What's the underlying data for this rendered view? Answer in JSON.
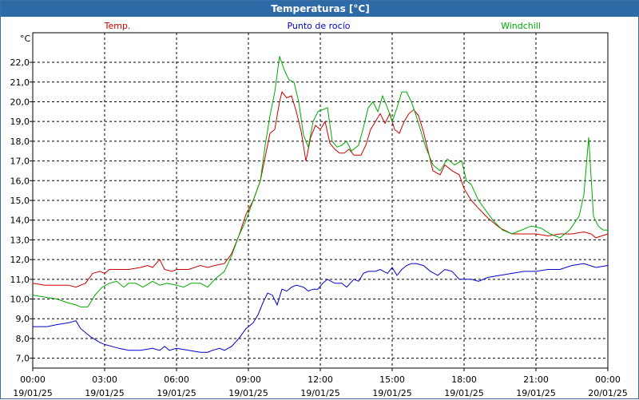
{
  "window": {
    "title": "Temperaturas [°C]"
  },
  "colors": {
    "temp": "#cc0000",
    "dew": "#0000cc",
    "chill": "#00aa00",
    "titlebar": "#2d6aa6",
    "grid": "#000000"
  },
  "chart_data": {
    "type": "line",
    "title": "Temperaturas [°C]",
    "unit_label": "°C",
    "grid": true,
    "ylim": [
      6.5,
      23.5
    ],
    "yticks": [
      "7,0",
      "8,0",
      "9,0",
      "10,0",
      "11,0",
      "12,0",
      "13,0",
      "14,0",
      "15,0",
      "16,0",
      "17,0",
      "18,0",
      "19,0",
      "20,0",
      "21,0",
      "22,0"
    ],
    "ytick_values": [
      7,
      8,
      9,
      10,
      11,
      12,
      13,
      14,
      15,
      16,
      17,
      18,
      19,
      20,
      21,
      22
    ],
    "xlim": [
      0,
      24
    ],
    "xticks": [
      {
        "h": 0,
        "time": "00:00",
        "date": "19/01/25"
      },
      {
        "h": 3,
        "time": "03:00",
        "date": "19/01/25"
      },
      {
        "h": 6,
        "time": "06:00",
        "date": "19/01/25"
      },
      {
        "h": 9,
        "time": "09:00",
        "date": "19/01/25"
      },
      {
        "h": 12,
        "time": "12:00",
        "date": "19/01/25"
      },
      {
        "h": 15,
        "time": "15:00",
        "date": "19/01/25"
      },
      {
        "h": 18,
        "time": "18:00",
        "date": "19/01/25"
      },
      {
        "h": 21,
        "time": "21:00",
        "date": "19/01/25"
      },
      {
        "h": 24,
        "time": "00:00",
        "date": "20/01/25"
      }
    ],
    "series": [
      {
        "name": "Temp.",
        "color": "#cc0000",
        "points": [
          [
            0,
            10.8
          ],
          [
            0.5,
            10.7
          ],
          [
            1,
            10.7
          ],
          [
            1.5,
            10.7
          ],
          [
            1.8,
            10.6
          ],
          [
            2,
            10.7
          ],
          [
            2.2,
            10.8
          ],
          [
            2.5,
            11.3
          ],
          [
            2.8,
            11.4
          ],
          [
            3,
            11.3
          ],
          [
            3.2,
            11.5
          ],
          [
            3.5,
            11.5
          ],
          [
            4,
            11.5
          ],
          [
            4.5,
            11.6
          ],
          [
            4.8,
            11.7
          ],
          [
            5,
            11.6
          ],
          [
            5.3,
            12.0
          ],
          [
            5.5,
            11.5
          ],
          [
            5.8,
            11.4
          ],
          [
            6,
            11.5
          ],
          [
            6.5,
            11.5
          ],
          [
            7,
            11.7
          ],
          [
            7.3,
            11.6
          ],
          [
            7.6,
            11.7
          ],
          [
            8,
            11.8
          ],
          [
            8.3,
            12.3
          ],
          [
            8.6,
            13.2
          ],
          [
            8.9,
            14.3
          ],
          [
            9.2,
            15.0
          ],
          [
            9.5,
            16.0
          ],
          [
            9.7,
            17.2
          ],
          [
            9.9,
            18.4
          ],
          [
            10.1,
            18.6
          ],
          [
            10.3,
            20.0
          ],
          [
            10.4,
            20.5
          ],
          [
            10.6,
            20.2
          ],
          [
            10.8,
            20.3
          ],
          [
            11,
            19.5
          ],
          [
            11.2,
            18.5
          ],
          [
            11.4,
            17.0
          ],
          [
            11.6,
            18.2
          ],
          [
            11.8,
            18.8
          ],
          [
            12,
            18.6
          ],
          [
            12.2,
            19.0
          ],
          [
            12.4,
            17.9
          ],
          [
            12.6,
            17.6
          ],
          [
            12.8,
            17.4
          ],
          [
            13,
            17.4
          ],
          [
            13.2,
            17.6
          ],
          [
            13.4,
            17.3
          ],
          [
            13.7,
            17.3
          ],
          [
            13.9,
            17.8
          ],
          [
            14.1,
            18.6
          ],
          [
            14.3,
            19.0
          ],
          [
            14.5,
            19.4
          ],
          [
            14.7,
            18.9
          ],
          [
            14.9,
            19.4
          ],
          [
            15.1,
            18.6
          ],
          [
            15.3,
            18.4
          ],
          [
            15.5,
            19.0
          ],
          [
            15.7,
            19.4
          ],
          [
            15.9,
            19.6
          ],
          [
            16.1,
            19.3
          ],
          [
            16.3,
            18.5
          ],
          [
            16.5,
            17.5
          ],
          [
            16.7,
            16.5
          ],
          [
            17,
            16.3
          ],
          [
            17.2,
            16.8
          ],
          [
            17.5,
            16.5
          ],
          [
            17.8,
            16.3
          ],
          [
            18,
            15.6
          ],
          [
            18.3,
            15.0
          ],
          [
            18.6,
            14.6
          ],
          [
            19,
            14.1
          ],
          [
            19.5,
            13.6
          ],
          [
            20,
            13.3
          ],
          [
            21,
            13.3
          ],
          [
            21.5,
            13.2
          ],
          [
            22,
            13.3
          ],
          [
            22.5,
            13.3
          ],
          [
            23,
            13.4
          ],
          [
            23.3,
            13.3
          ],
          [
            23.5,
            13.1
          ],
          [
            24,
            13.3
          ]
        ]
      },
      {
        "name": "Punto de rocío",
        "color": "#0000cc",
        "points": [
          [
            0,
            8.6
          ],
          [
            0.3,
            8.6
          ],
          [
            0.6,
            8.6
          ],
          [
            1,
            8.7
          ],
          [
            1.5,
            8.8
          ],
          [
            1.8,
            8.9
          ],
          [
            2,
            8.5
          ],
          [
            2.4,
            8.1
          ],
          [
            2.8,
            7.8
          ],
          [
            3,
            7.7
          ],
          [
            3.3,
            7.6
          ],
          [
            3.6,
            7.5
          ],
          [
            4,
            7.4
          ],
          [
            4.5,
            7.4
          ],
          [
            5,
            7.5
          ],
          [
            5.3,
            7.4
          ],
          [
            5.5,
            7.6
          ],
          [
            5.7,
            7.4
          ],
          [
            6,
            7.5
          ],
          [
            6.5,
            7.4
          ],
          [
            7,
            7.3
          ],
          [
            7.3,
            7.3
          ],
          [
            7.5,
            7.4
          ],
          [
            7.8,
            7.5
          ],
          [
            8,
            7.4
          ],
          [
            8.3,
            7.6
          ],
          [
            8.6,
            8.0
          ],
          [
            8.9,
            8.5
          ],
          [
            9.2,
            8.8
          ],
          [
            9.4,
            9.2
          ],
          [
            9.6,
            9.8
          ],
          [
            9.8,
            10.3
          ],
          [
            10,
            10.2
          ],
          [
            10.2,
            9.7
          ],
          [
            10.4,
            10.5
          ],
          [
            10.6,
            10.4
          ],
          [
            10.8,
            10.6
          ],
          [
            11,
            10.7
          ],
          [
            11.3,
            10.6
          ],
          [
            11.5,
            10.4
          ],
          [
            11.7,
            10.5
          ],
          [
            11.9,
            10.5
          ],
          [
            12.1,
            10.8
          ],
          [
            12.3,
            11.0
          ],
          [
            12.6,
            10.8
          ],
          [
            12.9,
            10.8
          ],
          [
            13.1,
            10.6
          ],
          [
            13.4,
            11.0
          ],
          [
            13.6,
            10.9
          ],
          [
            13.8,
            11.3
          ],
          [
            14,
            11.4
          ],
          [
            14.3,
            11.4
          ],
          [
            14.5,
            11.5
          ],
          [
            14.8,
            11.3
          ],
          [
            15,
            11.6
          ],
          [
            15.2,
            11.2
          ],
          [
            15.4,
            11.5
          ],
          [
            15.6,
            11.7
          ],
          [
            15.8,
            11.8
          ],
          [
            16,
            11.8
          ],
          [
            16.3,
            11.7
          ],
          [
            16.6,
            11.4
          ],
          [
            16.9,
            11.2
          ],
          [
            17.2,
            11.5
          ],
          [
            17.5,
            11.4
          ],
          [
            17.8,
            11.0
          ],
          [
            18,
            11.0
          ],
          [
            18.3,
            11.0
          ],
          [
            18.6,
            10.9
          ],
          [
            19,
            11.1
          ],
          [
            19.5,
            11.2
          ],
          [
            20,
            11.3
          ],
          [
            20.5,
            11.4
          ],
          [
            21,
            11.4
          ],
          [
            21.5,
            11.5
          ],
          [
            22,
            11.5
          ],
          [
            22.5,
            11.7
          ],
          [
            23,
            11.8
          ],
          [
            23.5,
            11.6
          ],
          [
            24,
            11.7
          ]
        ]
      },
      {
        "name": "Windchill",
        "color": "#00aa00",
        "points": [
          [
            0,
            10.2
          ],
          [
            0.5,
            10.1
          ],
          [
            1,
            10.0
          ],
          [
            1.5,
            9.8
          ],
          [
            1.8,
            9.7
          ],
          [
            2,
            9.6
          ],
          [
            2.3,
            9.6
          ],
          [
            2.6,
            10.2
          ],
          [
            2.9,
            10.6
          ],
          [
            3.2,
            10.8
          ],
          [
            3.5,
            10.9
          ],
          [
            3.8,
            10.6
          ],
          [
            4,
            10.8
          ],
          [
            4.3,
            10.8
          ],
          [
            4.6,
            10.6
          ],
          [
            5,
            10.9
          ],
          [
            5.3,
            10.7
          ],
          [
            5.6,
            10.8
          ],
          [
            6,
            10.7
          ],
          [
            6.3,
            10.6
          ],
          [
            6.6,
            10.8
          ],
          [
            7,
            10.8
          ],
          [
            7.3,
            10.6
          ],
          [
            7.6,
            11.0
          ],
          [
            8,
            11.4
          ],
          [
            8.3,
            12.2
          ],
          [
            8.6,
            13.2
          ],
          [
            8.9,
            14.0
          ],
          [
            9.2,
            15.0
          ],
          [
            9.5,
            16.0
          ],
          [
            9.7,
            17.8
          ],
          [
            9.9,
            19.3
          ],
          [
            10.1,
            20.5
          ],
          [
            10.3,
            22.3
          ],
          [
            10.5,
            21.6
          ],
          [
            10.7,
            21.1
          ],
          [
            10.9,
            21.0
          ],
          [
            11.1,
            20.0
          ],
          [
            11.3,
            18.3
          ],
          [
            11.5,
            17.7
          ],
          [
            11.7,
            19.0
          ],
          [
            11.9,
            19.5
          ],
          [
            12.1,
            19.6
          ],
          [
            12.3,
            19.7
          ],
          [
            12.5,
            18.0
          ],
          [
            12.7,
            17.7
          ],
          [
            12.9,
            17.8
          ],
          [
            13.1,
            18.0
          ],
          [
            13.3,
            17.5
          ],
          [
            13.6,
            17.8
          ],
          [
            13.8,
            18.7
          ],
          [
            14,
            19.7
          ],
          [
            14.2,
            20.0
          ],
          [
            14.4,
            19.5
          ],
          [
            14.6,
            20.3
          ],
          [
            14.8,
            19.7
          ],
          [
            15,
            19.0
          ],
          [
            15.2,
            19.7
          ],
          [
            15.4,
            20.5
          ],
          [
            15.6,
            20.5
          ],
          [
            15.8,
            20.0
          ],
          [
            16,
            19.3
          ],
          [
            16.2,
            18.5
          ],
          [
            16.4,
            17.7
          ],
          [
            16.7,
            16.8
          ],
          [
            17,
            16.5
          ],
          [
            17.3,
            17.1
          ],
          [
            17.6,
            16.8
          ],
          [
            17.9,
            17.0
          ],
          [
            18.1,
            16.0
          ],
          [
            18.3,
            15.8
          ],
          [
            18.6,
            15.0
          ],
          [
            18.9,
            14.5
          ],
          [
            19.2,
            14.0
          ],
          [
            19.6,
            13.5
          ],
          [
            20,
            13.3
          ],
          [
            20.4,
            13.5
          ],
          [
            20.8,
            13.7
          ],
          [
            21.2,
            13.6
          ],
          [
            21.6,
            13.3
          ],
          [
            22,
            13.1
          ],
          [
            22.4,
            13.5
          ],
          [
            22.8,
            14.2
          ],
          [
            23,
            15.3
          ],
          [
            23.2,
            18.2
          ],
          [
            23.4,
            14.2
          ],
          [
            23.6,
            13.7
          ],
          [
            23.8,
            13.5
          ],
          [
            24,
            13.5
          ]
        ]
      }
    ]
  }
}
